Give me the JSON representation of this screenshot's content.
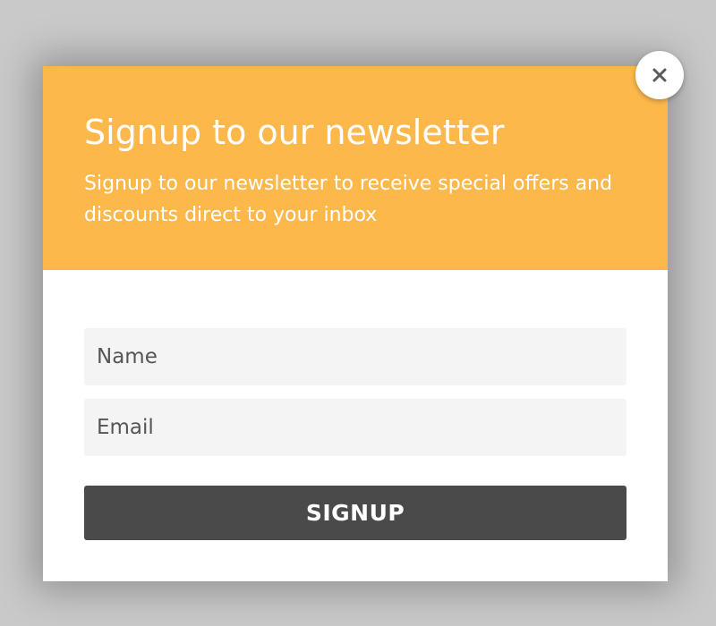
{
  "popup": {
    "title": "Signup to our newsletter",
    "subtitle": "Signup to our newsletter to receive special offers and discounts direct to your inbox",
    "name_placeholder": "Name",
    "name_value": "",
    "email_placeholder": "Email",
    "email_value": "",
    "signup_label": "SIGNUP",
    "close_icon": "close-icon"
  },
  "colors": {
    "header_bg": "#fdb84c",
    "button_bg": "#4a4a4a",
    "field_bg": "#f4f4f4",
    "overlay_bg": "#c9c9c9"
  }
}
